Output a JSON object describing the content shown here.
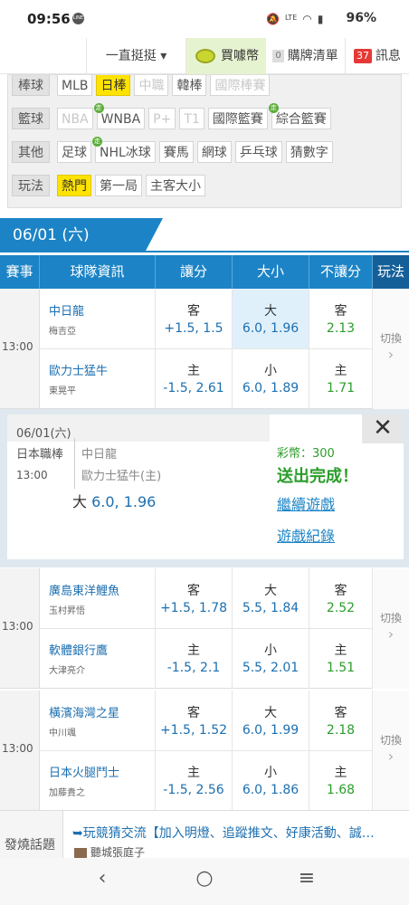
{
  "status": {
    "time": "09:56",
    "battery": "96%"
  },
  "topbar": {
    "filter_select": "一直挺挺 ▾",
    "buy_coins": "買噱幣",
    "cart_count": "0",
    "cart": "購牌清單",
    "msg_count": "37",
    "msg": "訊息"
  },
  "filters": [
    {
      "cat": "棒球",
      "tags": [
        {
          "t": "MLB"
        },
        {
          "t": "日棒",
          "on": true
        },
        {
          "t": "中職",
          "dis": true
        },
        {
          "t": "韓棒"
        },
        {
          "t": "國際棒賽",
          "dis": true
        }
      ]
    },
    {
      "cat": "籃球",
      "tags": [
        {
          "t": "NBA",
          "dis": true
        },
        {
          "t": "WNBA",
          "z": true
        },
        {
          "t": "P+",
          "dis": true
        },
        {
          "t": "T1",
          "dis": true
        },
        {
          "t": "國際籃賽"
        },
        {
          "t": "綜合籃賽",
          "z": true
        }
      ]
    },
    {
      "cat": "其他",
      "tags": [
        {
          "t": "足球"
        },
        {
          "t": "NHL冰球",
          "z": true
        },
        {
          "t": "賽馬"
        },
        {
          "t": "網球"
        },
        {
          "t": "乒乓球"
        },
        {
          "t": "猜數字"
        }
      ]
    },
    {
      "cat": "玩法",
      "tags": [
        {
          "t": "熱門",
          "on": true
        },
        {
          "t": "第一局"
        },
        {
          "t": "主客大小"
        }
      ]
    }
  ],
  "zou": "走",
  "date_tab": "06/01 (六)",
  "headers": {
    "c0": "賽事",
    "c1": "球隊資訊",
    "c2": "讓分",
    "c3": "大小",
    "c4": "不讓分",
    "c5": "玩法"
  },
  "games": [
    {
      "time": "13:00",
      "away": "中日龍",
      "away_p": "梅吉亞",
      "home": "歐力士猛牛",
      "home_p": "東晃平",
      "hc_a_k": "客",
      "hc_a_v": "+1.5, 1.5",
      "hc_h_k": "主",
      "hc_h_v": "-1.5, 2.61",
      "ou_a_k": "大",
      "ou_a_v": "6.0, 1.96",
      "ou_h_k": "小",
      "ou_h_v": "6.0, 1.89",
      "ml_a_k": "客",
      "ml_a_v": "2.13",
      "ml_h_k": "主",
      "ml_h_v": "1.71",
      "switch": "切換"
    },
    {
      "time": "13:00",
      "away": "廣島東洋鯉魚",
      "away_p": "玉村昇悟",
      "home": "軟體銀行鷹",
      "home_p": "大津亮介",
      "hc_a_k": "客",
      "hc_a_v": "+1.5, 1.78",
      "hc_h_k": "主",
      "hc_h_v": "-1.5, 2.1",
      "ou_a_k": "大",
      "ou_a_v": "5.5, 1.84",
      "ou_h_k": "小",
      "ou_h_v": "5.5, 2.01",
      "ml_a_k": "客",
      "ml_a_v": "2.52",
      "ml_h_k": "主",
      "ml_h_v": "1.51",
      "switch": "切換"
    },
    {
      "time": "13:00",
      "away": "橫濱海灣之星",
      "away_p": "中川颯",
      "home": "日本火腿鬥士",
      "home_p": "加藤貴之",
      "hc_a_k": "客",
      "hc_a_v": "+1.5, 1.52",
      "hc_h_k": "主",
      "hc_h_v": "-1.5, 2.56",
      "ou_a_k": "大",
      "ou_a_v": "6.0, 1.99",
      "ou_h_k": "小",
      "ou_h_v": "6.0, 1.86",
      "ml_a_k": "客",
      "ml_a_v": "2.18",
      "ml_h_k": "主",
      "ml_h_v": "1.68",
      "switch": "切換"
    }
  ],
  "overlay": {
    "date": "06/01(六)",
    "league": "日本職棒",
    "time": "13:00",
    "team1": "中日龍",
    "team2": "歐力士猛牛(主)",
    "bet_k": "大",
    "bet_v": "6.0, 1.96",
    "coins": "彩幣：300",
    "done": "送出完成！",
    "cont": "繼續遊戲",
    "record": "遊戲紀錄",
    "close": "✕"
  },
  "hot": {
    "label": "發燒話題",
    "text": "➥玩競猜交流【加入明燈、追蹤推文、好康活動、誠…",
    "sub": "聽城張庭子"
  }
}
